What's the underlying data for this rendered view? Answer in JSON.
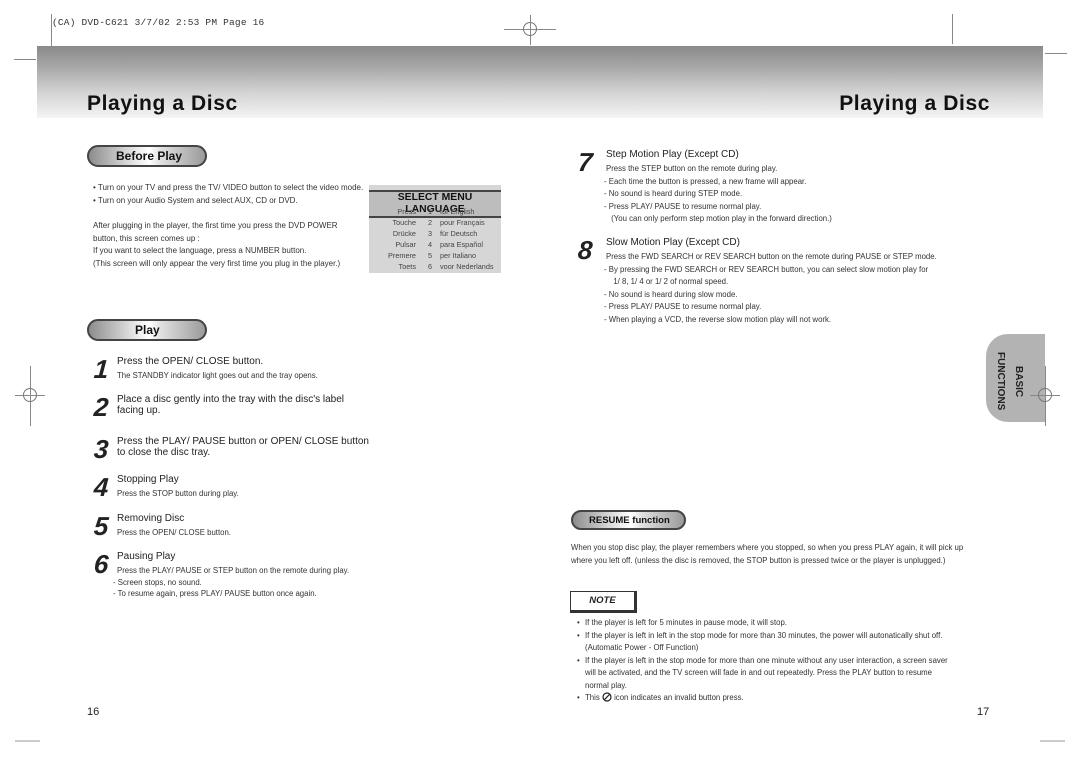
{
  "slug": "(CA) DVD-C621  3/7/02 2:53 PM  Page 16",
  "left_page": {
    "title": "Playing a Disc",
    "page_number": "16",
    "before_play": {
      "heading": "Before Play",
      "bullets": [
        "Turn on your TV and press the TV/ VIDEO button to select the video mode.",
        "Turn on your Audio System and select AUX, CD or DVD."
      ],
      "paragraph": [
        "After plugging in the player, the first time you press the DVD POWER",
        "button, this screen comes up :",
        "If you want to select the language, press a NUMBER button.",
        "(This screen will only appear the very first time you plug in the player.)"
      ]
    },
    "language_menu": {
      "heading": "SELECT MENU LANGUAGE",
      "rows": [
        {
          "verb": "Press",
          "num": "1",
          "lang": "for English"
        },
        {
          "verb": "Touche",
          "num": "2",
          "lang": "pour Français"
        },
        {
          "verb": "Drücke",
          "num": "3",
          "lang": "für Deutsch"
        },
        {
          "verb": "Pulsar",
          "num": "4",
          "lang": "para Español"
        },
        {
          "verb": "Premere",
          "num": "5",
          "lang": "per Italiano"
        },
        {
          "verb": "Toets",
          "num": "6",
          "lang": "voor Nederlands"
        }
      ]
    },
    "play": {
      "heading": "Play",
      "steps": [
        {
          "num": "1",
          "title": "Press the OPEN/ CLOSE button.",
          "lines": [
            "The STANDBY indicator light goes out and the tray opens."
          ]
        },
        {
          "num": "2",
          "title": "Place a disc gently into the tray with the disc's label",
          "title2": "facing up.",
          "lines": []
        },
        {
          "num": "3",
          "title": "Press the PLAY/ PAUSE button or OPEN/ CLOSE button",
          "title2": "to close the disc tray.",
          "lines": []
        },
        {
          "num": "4",
          "title": "Stopping Play",
          "lines": [
            "Press the STOP button during play."
          ]
        },
        {
          "num": "5",
          "title": "Removing Disc",
          "lines": [
            "Press the OPEN/ CLOSE button."
          ]
        },
        {
          "num": "6",
          "title": "Pausing Play",
          "lines": [
            "Press the PLAY/ PAUSE or STEP button on the remote during play.",
            "- Screen stops, no sound.",
            "- To resume again, press PLAY/ PAUSE button once again."
          ]
        }
      ]
    }
  },
  "right_page": {
    "title": "Playing a Disc",
    "page_number": "17",
    "side_tab": {
      "line1": "BASIC",
      "line2": "FUNCTIONS"
    },
    "steps": [
      {
        "num": "7",
        "title": "Step Motion Play (Except CD)",
        "lines": [
          "Press the STEP button on the remote during play.",
          "- Each time the button is pressed, a new frame will appear.",
          "- No sound is heard during STEP mode.",
          "- Press PLAY/ PAUSE to resume normal play.",
          " (You can only perform step motion play in the forward direction.)"
        ]
      },
      {
        "num": "8",
        "title": "Slow Motion Play (Except CD)",
        "lines": [
          "Press the FWD SEARCH or REV SEARCH button on the remote during PAUSE or STEP mode.",
          "- By pressing the FWD SEARCH or REV SEARCH button, you can select slow motion play for",
          "  1/ 8, 1/ 4 or 1/ 2 of normal speed.",
          "- No sound is heard during slow mode.",
          "- Press PLAY/ PAUSE to resume normal play.",
          "- When playing a VCD, the reverse slow motion play will not work."
        ]
      }
    ],
    "resume": {
      "heading": "RESUME function",
      "lines": [
        "When you stop disc play, the player remembers where you stopped, so when you press PLAY again, it will pick up",
        "where you left off. (unless the disc is removed, the STOP button is pressed twice or the player is unplugged.)"
      ]
    },
    "note": {
      "label": "NOTE",
      "bullets": [
        {
          "lines": [
            "If the player is left for 5 minutes in pause mode, it will stop."
          ]
        },
        {
          "lines": [
            "If the player is left in left in the stop mode for more than 30 minutes, the power will autonatically shut off.",
            "(Automatic Power - Off Function)"
          ]
        },
        {
          "lines": [
            "If the player is left in the stop mode for more than one minute without any user interaction, a screen saver",
            "will be activated, and the TV screen will fade in and out repeatedly. Press the PLAY button to resume",
            "normal play."
          ]
        }
      ],
      "last_prefix": "This",
      "last_suffix": "icon indicates an invalid button press."
    }
  }
}
